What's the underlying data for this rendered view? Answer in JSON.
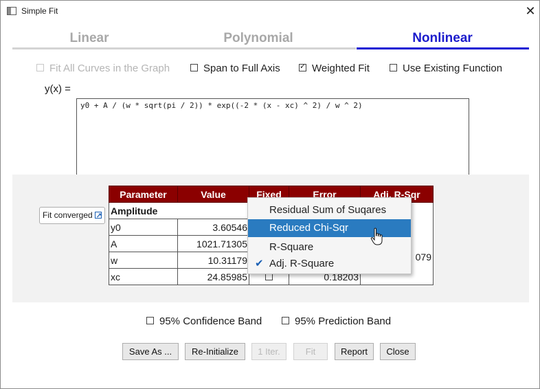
{
  "window": {
    "title": "Simple Fit",
    "close_glyph": "✕"
  },
  "tabs": [
    {
      "label": "Linear"
    },
    {
      "label": "Polynomial"
    },
    {
      "label": "Nonlinear"
    }
  ],
  "options": [
    {
      "label": "Fit All Curves in the Graph",
      "checked": false,
      "enabled": false
    },
    {
      "label": "Span to Full Axis",
      "checked": false,
      "enabled": true
    },
    {
      "label": "Weighted Fit",
      "checked": true,
      "enabled": true
    },
    {
      "label": "Use Existing Function",
      "checked": false,
      "enabled": true
    }
  ],
  "formula": {
    "label": "y(x) =",
    "value": "y0 + A / (w * sqrt(pi / 2)) * exp((-2 * (x - xc) ^ 2) / w ^ 2)"
  },
  "fit_status": {
    "label": "Fit converged",
    "icon": "external-link-icon"
  },
  "table": {
    "headers": [
      "Parameter",
      "Value",
      "Fixed",
      "Error",
      "Adj. R-Sqr"
    ],
    "group_label": "Amplitude",
    "rows": [
      {
        "param": "y0",
        "value": "3.60546",
        "fixed": false,
        "error": ""
      },
      {
        "param": "A",
        "value": "1021.71305",
        "fixed": false,
        "error": ""
      },
      {
        "param": "w",
        "value": "10.31179",
        "fixed": false,
        "error": ""
      },
      {
        "param": "xc",
        "value": "24.85985",
        "fixed": false,
        "error": "0.18203"
      }
    ],
    "adj_r_sqr_visible": "079"
  },
  "stat_menu": {
    "items": [
      {
        "label": "Residual Sum of Suqares",
        "checked": false,
        "highlighted": false
      },
      {
        "label": "Reduced Chi-Sqr",
        "checked": false,
        "highlighted": true
      },
      {
        "label": "R-Square",
        "checked": false,
        "highlighted": false
      },
      {
        "label": "Adj. R-Square",
        "checked": true,
        "highlighted": false
      }
    ],
    "check_glyph": "✔"
  },
  "bands": [
    {
      "label": "95% Confidence Band",
      "checked": false
    },
    {
      "label": "95% Prediction Band",
      "checked": false
    }
  ],
  "buttons": [
    {
      "label": "Save As ...",
      "enabled": true
    },
    {
      "label": "Re-Initialize",
      "enabled": true
    },
    {
      "label": "1 Iter.",
      "enabled": false
    },
    {
      "label": "Fit",
      "enabled": false
    },
    {
      "label": "Report",
      "enabled": true
    },
    {
      "label": "Close",
      "enabled": true
    }
  ],
  "colors": {
    "active_tab": "#1c1ccc",
    "inactive_tab": "#a8a8a8",
    "table_header": "#8b0000",
    "menu_highlight": "#2a7bc0"
  }
}
